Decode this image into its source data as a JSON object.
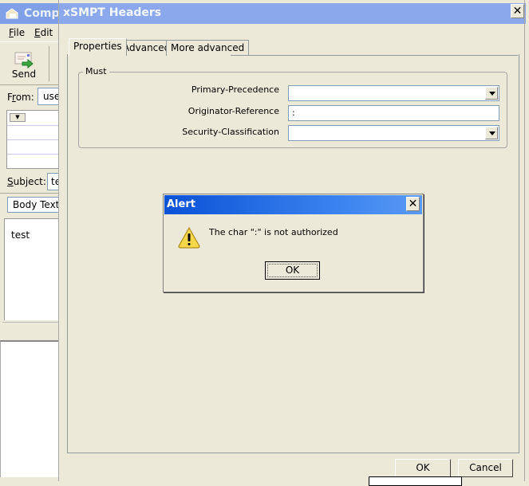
{
  "compose_window": {
    "title": "Compo",
    "menu": [
      {
        "label": "File",
        "mnemonic": "F",
        "rest": "ile"
      },
      {
        "label": "Edit",
        "mnemonic": "E",
        "rest": "dit"
      }
    ],
    "toolbar": {
      "send_label": "Send"
    },
    "from_label_pre": "F",
    "from_label_mn": "r",
    "from_label_post": "om:",
    "from_value": "use",
    "subject_label_mn": "S",
    "subject_label_post": "ubject:",
    "subject_value": "te",
    "format_value": "Body Text",
    "body_text": "test"
  },
  "dialog": {
    "title": "xSMPT Headers",
    "close_glyph": "✕",
    "tabs": [
      {
        "label": "Properties",
        "active": true
      },
      {
        "label": "Advanced",
        "active": false
      },
      {
        "label": "More advanced",
        "active": false
      }
    ],
    "group_title": "Must",
    "fields": [
      {
        "label": "Primary-Precedence",
        "value": "",
        "type": "dropdown"
      },
      {
        "label": "Originator-Reference",
        "value": ":",
        "type": "text"
      },
      {
        "label": "Security-Classification",
        "value": "",
        "type": "dropdown"
      }
    ],
    "ok_label": "OK",
    "cancel_label": "Cancel"
  },
  "alert": {
    "title": "Alert",
    "close_glyph": "✕",
    "icon": "warning-icon",
    "message": "The char \":\" is not authorized",
    "ok_label": "OK"
  },
  "colors": {
    "inactive_titlebar": "#8ba8ec",
    "active_titlebar": "#0a52d6",
    "window_bg": "#ece9d8"
  }
}
